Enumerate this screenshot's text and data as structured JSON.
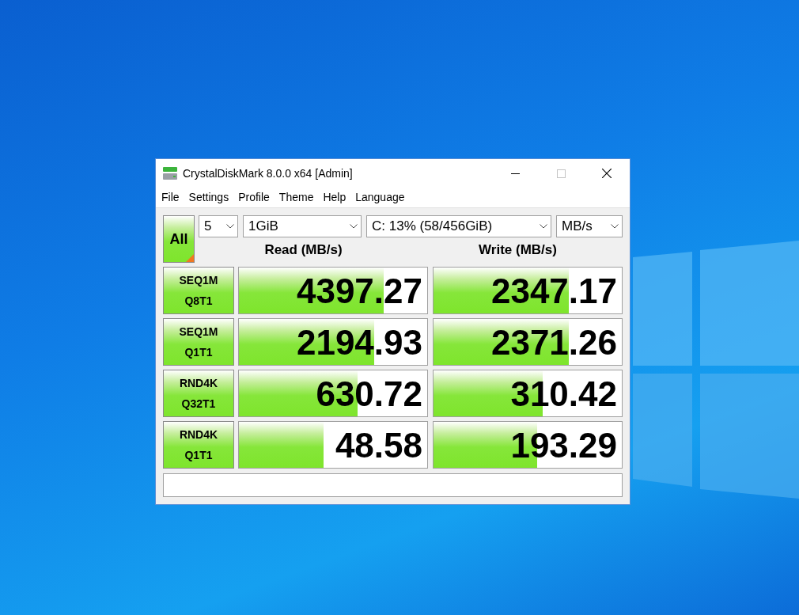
{
  "window": {
    "title": "CrystalDiskMark 8.0.0 x64 [Admin]"
  },
  "menu": [
    "File",
    "Settings",
    "Profile",
    "Theme",
    "Help",
    "Language"
  ],
  "all_button": {
    "label": "All"
  },
  "selectors": [
    {
      "value": "5"
    },
    {
      "value": "1GiB"
    },
    {
      "value": "C: 13% (58/456GiB)"
    },
    {
      "value": "MB/s"
    }
  ],
  "columns": [
    "Read (MB/s)",
    "Write (MB/s)"
  ],
  "rows": [
    {
      "test": [
        "SEQ1M",
        "Q8T1"
      ],
      "read": {
        "value": "4397.27",
        "level": 0.77
      },
      "write": {
        "value": "2347.17",
        "level": 0.72
      }
    },
    {
      "test": [
        "SEQ1M",
        "Q1T1"
      ],
      "read": {
        "value": "2194.93",
        "level": 0.72
      },
      "write": {
        "value": "2371.26",
        "level": 0.72
      }
    },
    {
      "test": [
        "RND4K",
        "Q32T1"
      ],
      "read": {
        "value": "630.72",
        "level": 0.63
      },
      "write": {
        "value": "310.42",
        "level": 0.58
      }
    },
    {
      "test": [
        "RND4K",
        "Q1T1"
      ],
      "read": {
        "value": "48.58",
        "level": 0.45
      },
      "write": {
        "value": "193.29",
        "level": 0.55
      }
    }
  ]
}
